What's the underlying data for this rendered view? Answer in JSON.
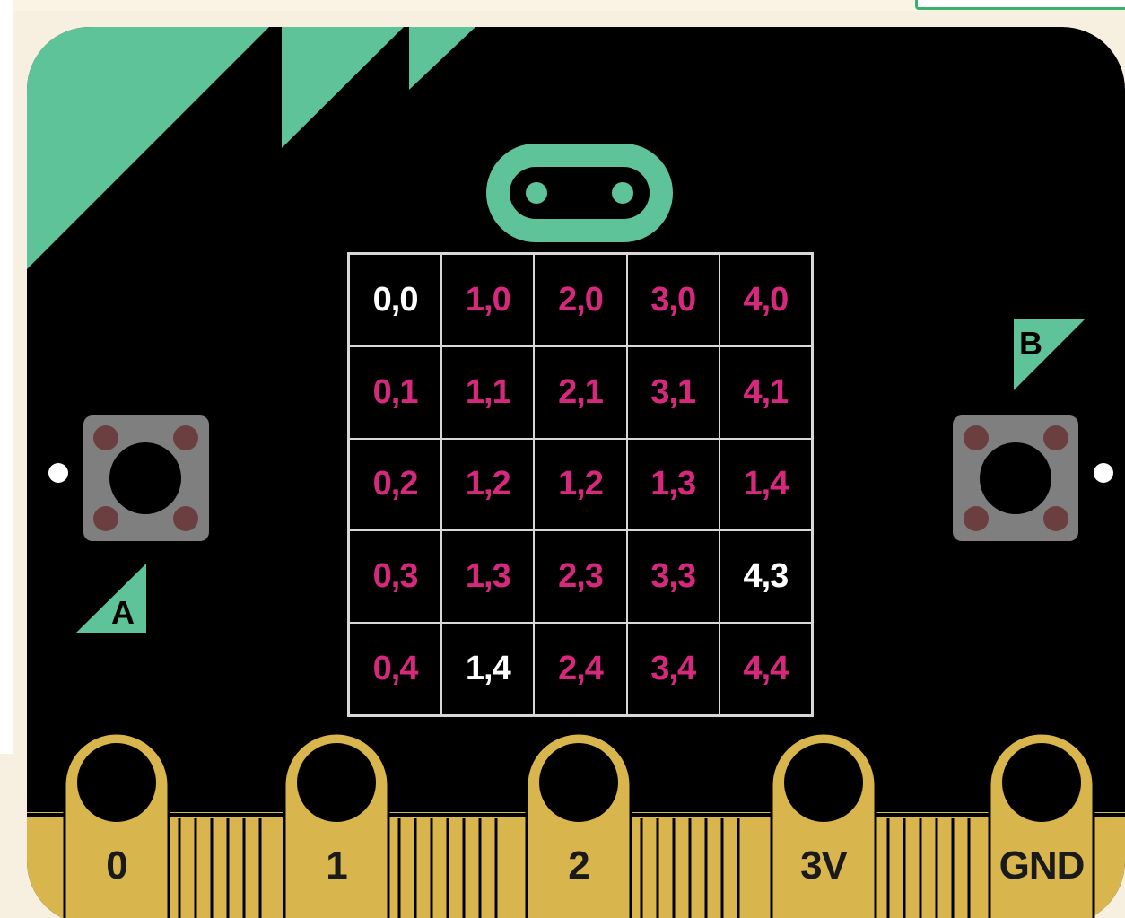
{
  "colors": {
    "board": "#000000",
    "accent_green": "#5fc39a",
    "gold": "#d9b64d",
    "highlight_text": "#ffffff",
    "default_text": "#d6287c"
  },
  "buttons": {
    "a_label": "A",
    "b_label": "B"
  },
  "grid": {
    "rows": [
      [
        {
          "label": "0,0",
          "lit": true
        },
        {
          "label": "1,0",
          "lit": false
        },
        {
          "label": "2,0",
          "lit": false
        },
        {
          "label": "3,0",
          "lit": false
        },
        {
          "label": "4,0",
          "lit": false
        }
      ],
      [
        {
          "label": "0,1",
          "lit": false
        },
        {
          "label": "1,1",
          "lit": false
        },
        {
          "label": "2,1",
          "lit": false
        },
        {
          "label": "3,1",
          "lit": false
        },
        {
          "label": "4,1",
          "lit": false
        }
      ],
      [
        {
          "label": "0,2",
          "lit": false
        },
        {
          "label": "1,2",
          "lit": false
        },
        {
          "label": "1,2",
          "lit": false
        },
        {
          "label": "1,3",
          "lit": false
        },
        {
          "label": "1,4",
          "lit": false
        }
      ],
      [
        {
          "label": "0,3",
          "lit": false
        },
        {
          "label": "1,3",
          "lit": false
        },
        {
          "label": "2,3",
          "lit": false
        },
        {
          "label": "3,3",
          "lit": false
        },
        {
          "label": "4,3",
          "lit": true
        }
      ],
      [
        {
          "label": "0,4",
          "lit": false
        },
        {
          "label": "1,4",
          "lit": true
        },
        {
          "label": "2,4",
          "lit": false
        },
        {
          "label": "3,4",
          "lit": false
        },
        {
          "label": "4,4",
          "lit": false
        }
      ]
    ]
  },
  "pins": [
    {
      "label": "0"
    },
    {
      "label": "1"
    },
    {
      "label": "2"
    },
    {
      "label": "3V"
    },
    {
      "label": "GND"
    }
  ]
}
